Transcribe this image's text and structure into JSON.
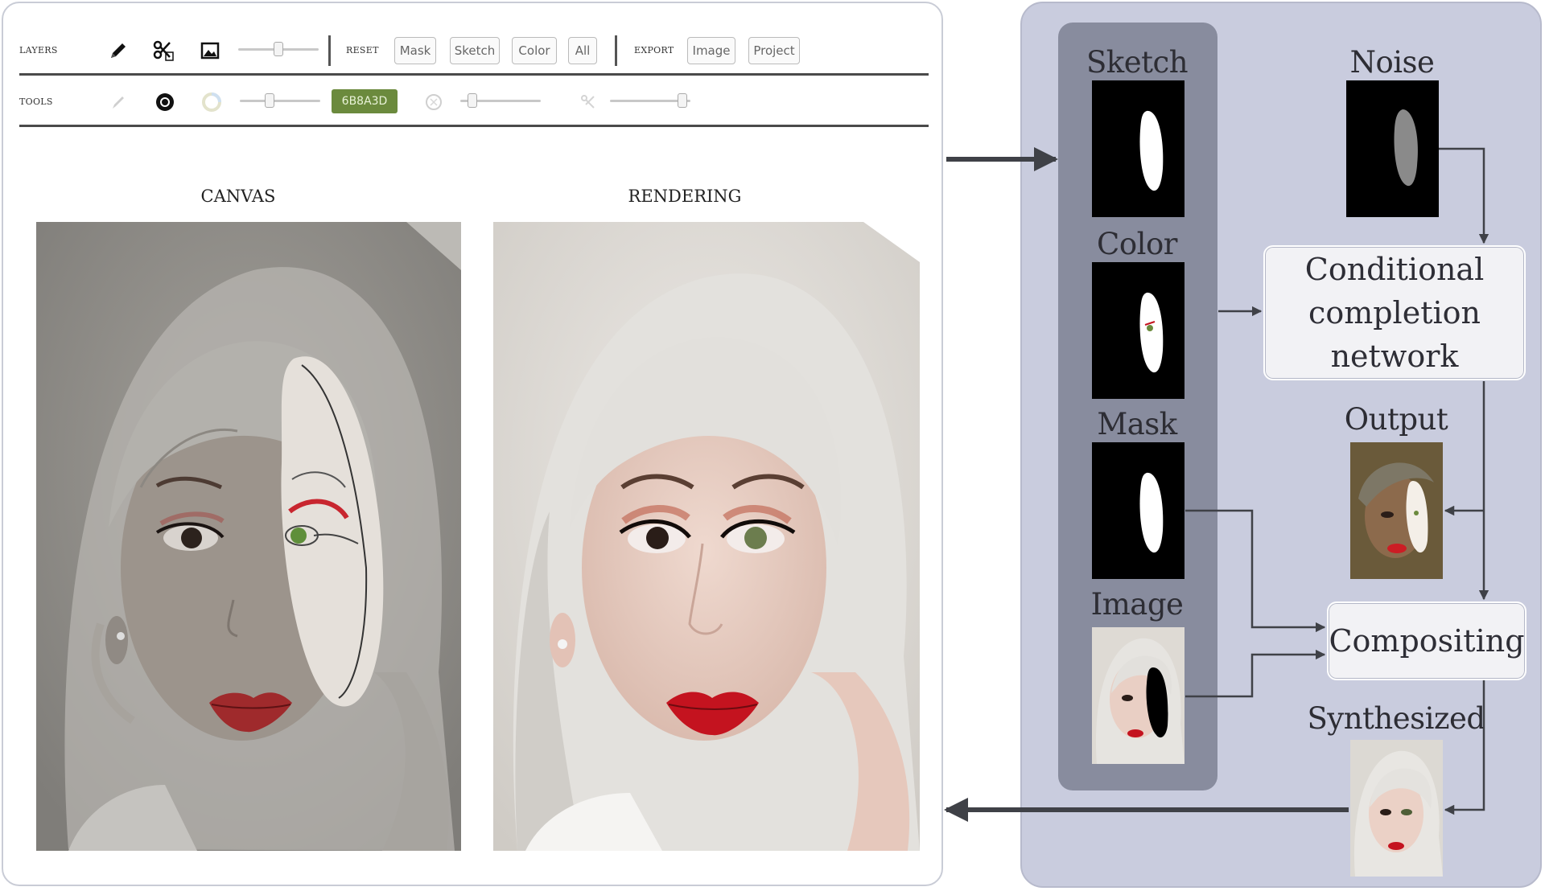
{
  "toolbar": {
    "layers_label": "LAYERS",
    "tools_label": "TOOLS",
    "reset_label": "RESET",
    "export_label": "EXPORT",
    "reset_buttons": [
      "Mask",
      "Sketch",
      "Color",
      "All"
    ],
    "export_buttons": [
      "Image",
      "Project"
    ],
    "color_value": "6B8A3D",
    "layer_opacity": 0.5,
    "tool_size": 0.35,
    "tolerance": 0.1,
    "stroke_width": 0.95
  },
  "views": {
    "canvas_title": "CANVAS",
    "rendering_title": "RENDERING"
  },
  "diagram": {
    "inputs": {
      "sketch": "Sketch",
      "color": "Color",
      "mask": "Mask",
      "image": "Image"
    },
    "noise": "Noise",
    "network_line1": "Conditional",
    "network_line2": "completion network",
    "output": "Output",
    "compositing": "Compositing",
    "synthesized": "Synthesized"
  },
  "colors": {
    "swatch": "#6b8a3d",
    "panel_bg": "#c9ccde",
    "group_bg": "#888c9e",
    "arrow": "#3f4147",
    "lip_red": "#b3232c",
    "eye_green": "#5f8f3a"
  }
}
